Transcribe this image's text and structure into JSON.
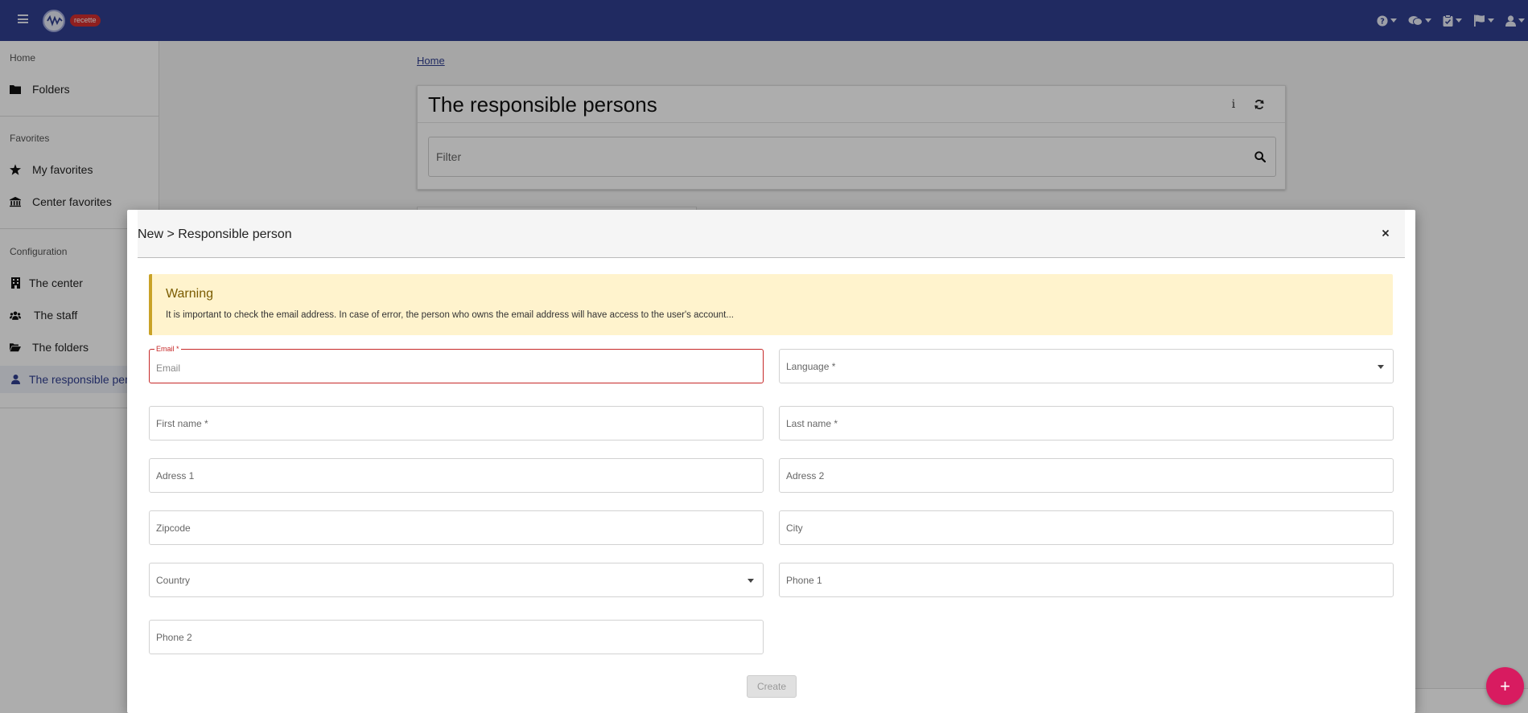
{
  "topbar": {
    "env_badge": "recette",
    "icons": [
      "help-icon",
      "chat-icon",
      "clipboard-icon",
      "flag-icon",
      "user-icon"
    ],
    "color": "#303f8f"
  },
  "sidebar": {
    "sections": [
      {
        "title": "Home",
        "items": [
          {
            "label": "Folders",
            "icon": "folder-icon"
          }
        ]
      },
      {
        "title": "Favorites",
        "items": [
          {
            "label": "My favorites",
            "icon": "star-icon"
          },
          {
            "label": "Center favorites",
            "icon": "building-icon"
          }
        ]
      },
      {
        "title": "Configuration",
        "items": [
          {
            "label": "The center",
            "icon": "office-icon"
          },
          {
            "label": "The staff",
            "icon": "users-icon"
          },
          {
            "label": "The folders",
            "icon": "folder-open-icon"
          },
          {
            "label": "The responsible persons",
            "icon": "person-icon",
            "active": true
          }
        ]
      }
    ]
  },
  "main": {
    "breadcrumb": "Home",
    "card_title": "The responsible persons",
    "filter_placeholder": "Filter"
  },
  "modal": {
    "title": "New > Responsible person",
    "warning": {
      "title": "Warning",
      "text": "It is important to check the email address. In case of error, the person who owns the email address will have access to the user's account..."
    },
    "fields": {
      "email_label": "Email *",
      "email_placeholder": "Email",
      "language": "Language *",
      "first_name": "First name *",
      "last_name": "Last name *",
      "address1": "Adress 1",
      "address2": "Adress 2",
      "zipcode": "Zipcode",
      "city": "City",
      "country": "Country",
      "phone1": "Phone 1",
      "phone2": "Phone 2"
    },
    "create_label": "Create"
  },
  "fab_label": "+"
}
